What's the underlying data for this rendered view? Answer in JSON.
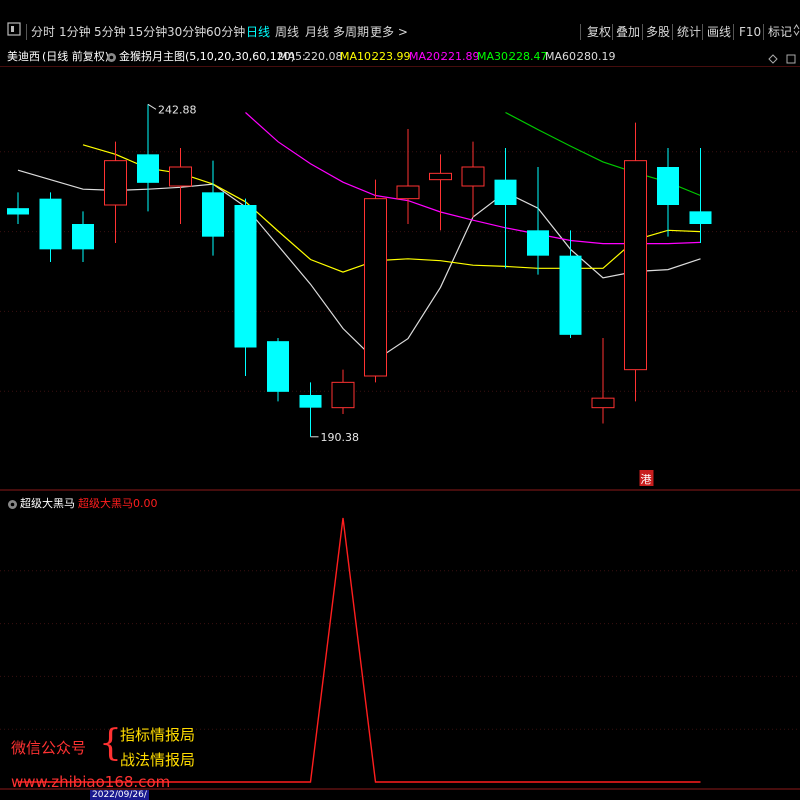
{
  "toolbar": {
    "left_icon": "square-icon",
    "periods": [
      "分时",
      "1分钟",
      "5分钟",
      "15分钟",
      "30分钟",
      "60分钟",
      "日线",
      "周线",
      "月线",
      "多周期",
      "更多 >"
    ],
    "active_period": "日线",
    "right_buttons": [
      "复权",
      "叠加",
      "多股",
      "统计",
      "画线",
      "F10",
      "标记"
    ],
    "right_icon": "arrows-icon"
  },
  "info": {
    "stock_name": "美迪西",
    "mode": "(日线 前复权)",
    "indicator_name": "金猴拐月主图(5,10,20,30,60,120)",
    "ma5_label": "MA5:",
    "ma5_value": "220.08",
    "ma10_label": "MA10:",
    "ma10_value": "223.99",
    "ma20_label": "MA20:",
    "ma20_value": "221.89",
    "ma30_label": "MA30:",
    "ma30_value": "228.47",
    "ma60_label": "MA60:",
    "ma60_value": "280.19",
    "right_icons": [
      "diamond-icon",
      "square-icon"
    ]
  },
  "sub": {
    "indicator_name": "超级大黑马",
    "indicator_label": "超级大黑马",
    "indicator_value": "0.00"
  },
  "watermark": {
    "line1": "微信公众号",
    "line2a": "指标情报局",
    "line2b": "战法情报局",
    "url": "www.zhibiao168.com"
  },
  "date_bar": {
    "date": "2022/09/26/"
  },
  "colors": {
    "up": "#ff3232",
    "down": "#00ffff",
    "ma5": "#dcdcdc",
    "ma10": "#ffff00",
    "ma20": "#ff00ff",
    "ma30": "#00c800",
    "ma60": "#c8c8c8",
    "active": "#00ffff",
    "indicator": "#ff1e1e"
  },
  "chart_data": {
    "type": "candlestick",
    "title": "美迪西 (日线 前复权)",
    "price_range": [
      185,
      248
    ],
    "annotations": [
      {
        "text": "242.88",
        "kind": "high",
        "index": 4
      },
      {
        "text": "190.38",
        "kind": "low",
        "index": 9
      },
      {
        "text": "港",
        "kind": "badge",
        "index": 19
      }
    ],
    "candles": [
      {
        "o": 226.5,
        "h": 229,
        "l": 224,
        "c": 225.5
      },
      {
        "o": 228,
        "h": 229,
        "l": 218,
        "c": 220
      },
      {
        "o": 224,
        "h": 226,
        "l": 218,
        "c": 220
      },
      {
        "o": 227,
        "h": 237,
        "l": 221,
        "c": 234
      },
      {
        "o": 235,
        "h": 242.9,
        "l": 226,
        "c": 230.5
      },
      {
        "o": 230,
        "h": 236,
        "l": 224,
        "c": 233
      },
      {
        "o": 229,
        "h": 234,
        "l": 219,
        "c": 222
      },
      {
        "o": 227,
        "h": 228,
        "l": 200,
        "c": 204.5
      },
      {
        "o": 205.5,
        "h": 206,
        "l": 196,
        "c": 197.5
      },
      {
        "o": 197,
        "h": 199,
        "l": 190.4,
        "c": 195
      },
      {
        "o": 195,
        "h": 201,
        "l": 194,
        "c": 199
      },
      {
        "o": 200,
        "h": 231,
        "l": 199,
        "c": 228
      },
      {
        "o": 228,
        "h": 239,
        "l": 224,
        "c": 230
      },
      {
        "o": 231,
        "h": 235,
        "l": 223,
        "c": 232
      },
      {
        "o": 230,
        "h": 237,
        "l": 225,
        "c": 233
      },
      {
        "o": 231,
        "h": 236,
        "l": 217,
        "c": 227
      },
      {
        "o": 223,
        "h": 233,
        "l": 216,
        "c": 219
      },
      {
        "o": 219,
        "h": 223,
        "l": 206,
        "c": 206.5
      },
      {
        "o": 195,
        "h": 206,
        "l": 192.5,
        "c": 196.5
      },
      {
        "o": 201,
        "h": 240,
        "l": 196,
        "c": 234
      },
      {
        "o": 233,
        "h": 236,
        "l": 222,
        "c": 227
      },
      {
        "o": 226,
        "h": 236,
        "l": 221,
        "c": 224
      }
    ],
    "series": [
      {
        "name": "MA5",
        "values": [
          232.5,
          null,
          229.5,
          229.3,
          229.5,
          229.8,
          230.3,
          226.7,
          220.6,
          214.5,
          207.5,
          202.5,
          205.9,
          214,
          225.1,
          229,
          226.5,
          220,
          215.5,
          216.5,
          216.8,
          218.5
        ]
      },
      {
        "name": "MA10",
        "values": [
          null,
          null,
          236.5,
          235,
          232.8,
          232,
          230.3,
          227.5,
          222.9,
          218.4,
          216.4,
          218.2,
          218.5,
          218.2,
          217.5,
          217.3,
          217,
          217,
          217,
          221.5,
          223,
          222.8
        ]
      },
      {
        "name": "MA20",
        "values": [
          null,
          null,
          null,
          null,
          null,
          null,
          null,
          241.6,
          237,
          233.5,
          230.6,
          228.5,
          227.7,
          225.9,
          224.6,
          223.4,
          222.4,
          221.4,
          220.9,
          220.9,
          220.9,
          221.1
        ]
      },
      {
        "name": "MA30",
        "values": [
          null,
          null,
          null,
          null,
          null,
          null,
          null,
          null,
          null,
          null,
          null,
          null,
          null,
          null,
          null,
          241.6,
          238.9,
          236.3,
          233.8,
          232.1,
          230.6,
          228.5
        ]
      }
    ],
    "indicator": {
      "name": "超级大黑马",
      "range": [
        0,
        1
      ],
      "values": [
        0,
        0,
        0,
        0,
        0,
        0,
        0,
        0,
        0,
        0,
        1,
        0,
        0,
        0,
        0,
        0,
        0,
        0,
        0,
        0,
        0,
        0
      ]
    }
  }
}
